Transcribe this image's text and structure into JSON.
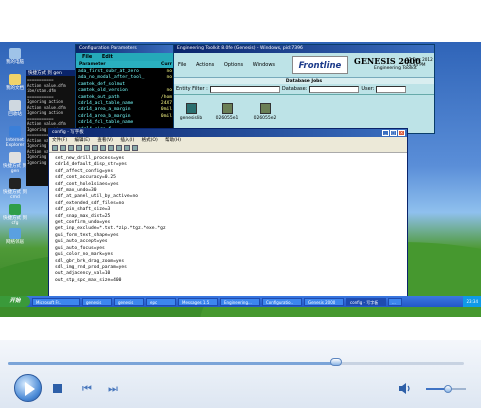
{
  "desktop_icons": [
    "我的电脑",
    "我的文档",
    "回收站",
    "Internet Explorer",
    "快捷方式 到 gen",
    "快捷方式 到 cmd",
    "快捷方式 到 cfg",
    "网络邻居"
  ],
  "bg_console": {
    "title": "快捷方式 到 gen",
    "lines": [
      "===========",
      "Action value.dfm",
      "ibe/stan.dfm",
      "===========",
      "Ignoring action",
      "Action value.dfm",
      "Ignoring action",
      "===========",
      "Action value.dfm",
      "Ignoring action",
      "===========",
      "Action value.dfm",
      "Ignoring action",
      "Action value.dfm",
      "Ignoring action",
      "Ignoring action"
    ]
  },
  "config_window": {
    "title": "Configuration Parameters",
    "menu": [
      "File",
      "Edit"
    ],
    "header": {
      "parameter": "Parameter",
      "current": "Curr"
    },
    "rows": [
      {
        "name": "ada_first_subr_at_zero",
        "value": "no"
      },
      {
        "name": "ada_no_modal_after_tool_",
        "value": "no"
      },
      {
        "name": "camtek_def_solmut",
        "value": ""
      },
      {
        "name": "camtek_old_version",
        "value": "no"
      },
      {
        "name": "camtek_out_path",
        "value": "/hom"
      },
      {
        "name": "cdr14_acl_table_name",
        "value": "24X7"
      },
      {
        "name": "cdr14_area_a_margin",
        "value": "0mil"
      },
      {
        "name": "cdr14_area_b_margin",
        "value": "0mil"
      },
      {
        "name": "cdr14_fcl_table_name",
        "value": ""
      },
      {
        "name": "cdr14_size_f",
        "value": ""
      }
    ]
  },
  "eng_window": {
    "title": "Engineering Toolkit 8.0fe (Genesis) - Windows, pid:7396",
    "menu": [
      "File",
      "Actions",
      "Options",
      "Windows"
    ],
    "logo": "Frontline",
    "genesis": {
      "name": "GENESIS 2000",
      "sub": "Engineering Toolkit",
      "date": "27 Dec 2012",
      "time": "11:34 PM"
    },
    "db_bar": "Database Jobs",
    "filters": {
      "entity": "Entity Filter :",
      "database": "Database:",
      "user": "User:"
    },
    "jobs": [
      "genesislib",
      "026055e1",
      "026055e2"
    ]
  },
  "notepad": {
    "title": "config - 写字板",
    "menu": [
      "文件(F)",
      "编辑(E)",
      "查看(V)",
      "插入(I)",
      "格式(O)",
      "帮助(H)"
    ],
    "lines": [
      "set_new_drill_process=yes",
      "cdr14_default_disp_str=yes",
      "sdf_affect_config=yes",
      "sdf_cont_accuracy=0.25",
      "sdf_cont_hole1siaes=yes",
      "sdf_max_undo=30",
      "sdf_at_panel_util_by_active=no",
      "sdf_extended_sdf_files=no",
      "sdf_pin_shaft_size=3",
      "sdf_snap_max_dist=25",
      "get_confirm_undo=yes",
      "get_inp_exclude=*.txt.*zip.*tgz.*exe.*gz",
      "gui_form_text_shape=yes",
      "gui_auto_accept=yes",
      "gui_auto_focus=yes",
      "gui_color_no_mark=yes",
      "sdl_gbr_brk_drag_zoom=yes",
      "sdl_img_rnd_prod_param=yes",
      "out_adjacency_val=10",
      "out_stp_spc_max_size=400"
    ]
  },
  "taskbar": {
    "start": "开始",
    "tasks": [
      "Microsoft Fr..",
      "genesis",
      "genesis",
      "epc",
      "Messages 1.5",
      "Engineering...",
      "Configuratio..",
      "Genesis 2000",
      "config - 写字板",
      "..."
    ],
    "tray": "23:34"
  },
  "player": {
    "seek_progress": 0.72,
    "volume": 0.55,
    "colors": {
      "accent": "#4b8ad6",
      "track": "#c8d3e2"
    }
  }
}
